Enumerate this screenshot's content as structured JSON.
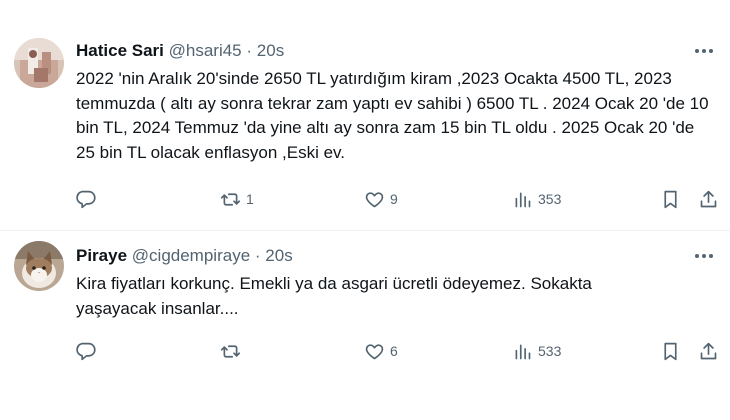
{
  "tweets": [
    {
      "name": "Hatice Sari",
      "handle": "@hsari45",
      "separator": "·",
      "time": "20s",
      "text": "2022 'nin Aralık 20'sinde 2650 TL yatırdığım kiram ,2023 Ocakta 4500 TL, 2023 temmuzda ( altı ay sonra tekrar zam yaptı ev sahibi ) 6500 TL . 2024 Ocak 20 'de 10 bin TL, 2024 Temmuz 'da yine altı ay sonra zam 15 bin TL oldu . 2025 Ocak 20 'de 25 bin TL olacak enflasyon ,Eski ev.",
      "replies": "",
      "retweets": "1",
      "likes": "9",
      "views": "353",
      "avatar_icon": "profile-photo"
    },
    {
      "name": "Piraye",
      "handle": "@cigdempiraye",
      "separator": "·",
      "time": "20s",
      "text": "Kira fiyatları korkunç. Emekli ya da asgari ücretli ödeyemez. Sokakta yaşayacak insanlar....",
      "replies": "",
      "retweets": "",
      "likes": "6",
      "views": "533",
      "avatar_icon": "cat-photo"
    }
  ],
  "icons": {
    "reply": "reply-icon",
    "retweet": "retweet-icon",
    "like": "heart-icon",
    "views": "views-icon",
    "bookmark": "bookmark-icon",
    "share": "share-icon",
    "more": "more-icon"
  },
  "colors": {
    "text": "#0f1419",
    "secondary": "#536471",
    "divider": "#eff3f4"
  }
}
